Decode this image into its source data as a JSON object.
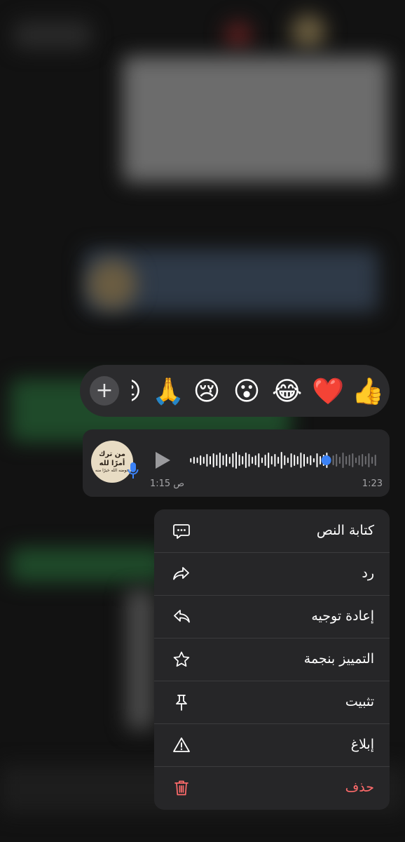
{
  "reaction_bar": {
    "add_symbol": "+",
    "emojis": [
      "👍",
      "❤️",
      "😂",
      "😮",
      "😢",
      "🙏",
      "😐"
    ]
  },
  "voice_message": {
    "avatar_text_line1": "من ترك أمرًا لله",
    "avatar_text_line2": "عوضه الله خيرًا منه",
    "duration": "1:23",
    "sent_time": "1:15 ص",
    "progress": 0.73
  },
  "context_menu": {
    "items": [
      {
        "label": "كتابة النص",
        "icon": "transcript-icon"
      },
      {
        "label": "رد",
        "icon": "reply-icon"
      },
      {
        "label": "إعادة توجيه",
        "icon": "forward-icon"
      },
      {
        "label": "التمييز بنجمة",
        "icon": "star-icon"
      },
      {
        "label": "تثبيت",
        "icon": "pin-icon"
      },
      {
        "label": "إبلاغ",
        "icon": "report-icon"
      },
      {
        "label": "حذف",
        "icon": "trash-icon"
      }
    ]
  },
  "colors": {
    "accent_blue": "#3b82f6",
    "danger_red": "#ff6b6b",
    "panel_bg": "#262628"
  }
}
